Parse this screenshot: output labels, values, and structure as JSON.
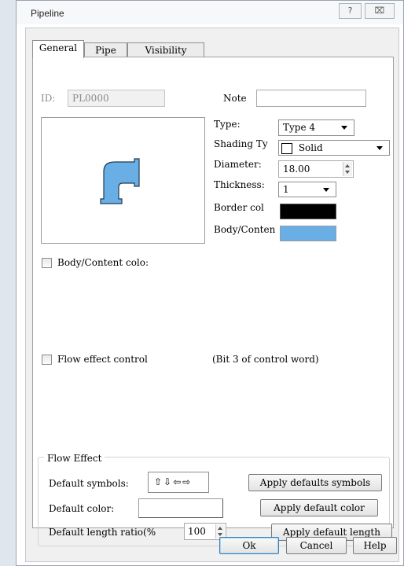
{
  "window": {
    "title": "Pipeline",
    "help_glyph": "?",
    "close_glyph": "⌧"
  },
  "tabs": [
    {
      "label": "General",
      "active": true
    },
    {
      "label": "Pipe",
      "active": false
    },
    {
      "label": "Visibility",
      "active": false
    }
  ],
  "general": {
    "id_label": "ID:",
    "id_value": "PL0000",
    "note_label": "Note",
    "note_value": "",
    "type_label": "Type:",
    "type_value": "Type 4",
    "shading_label": "Shading Ty",
    "shading_value": "Solid",
    "diameter_label": "Diameter:",
    "diameter_value": "18.00",
    "thickness_label": "Thickness:",
    "thickness_value": "1",
    "border_color_label": "Border col",
    "border_color": "#000000",
    "body_color_label": "Body/Conten",
    "body_color": "#6aaee6",
    "body_content_checkbox_label": "Body/Content colo:",
    "flow_effect_checkbox_label": "Flow effect control",
    "flow_effect_note": "(Bit 3 of control word)"
  },
  "flow_effect": {
    "group_title": "Flow Effect",
    "default_symbols_label": "Default symbols:",
    "default_symbols_value": "⇧⇩⇦⇨",
    "apply_symbols_label": "Apply defaults symbols",
    "default_color_label": "Default color:",
    "apply_color_label": "Apply default color",
    "default_length_label": "Default length ratio(%",
    "default_length_value": "100",
    "apply_length_label": "Apply default length"
  },
  "footer": {
    "ok_label": "Ok",
    "cancel_label": "Cancel",
    "help_label": "Help"
  }
}
